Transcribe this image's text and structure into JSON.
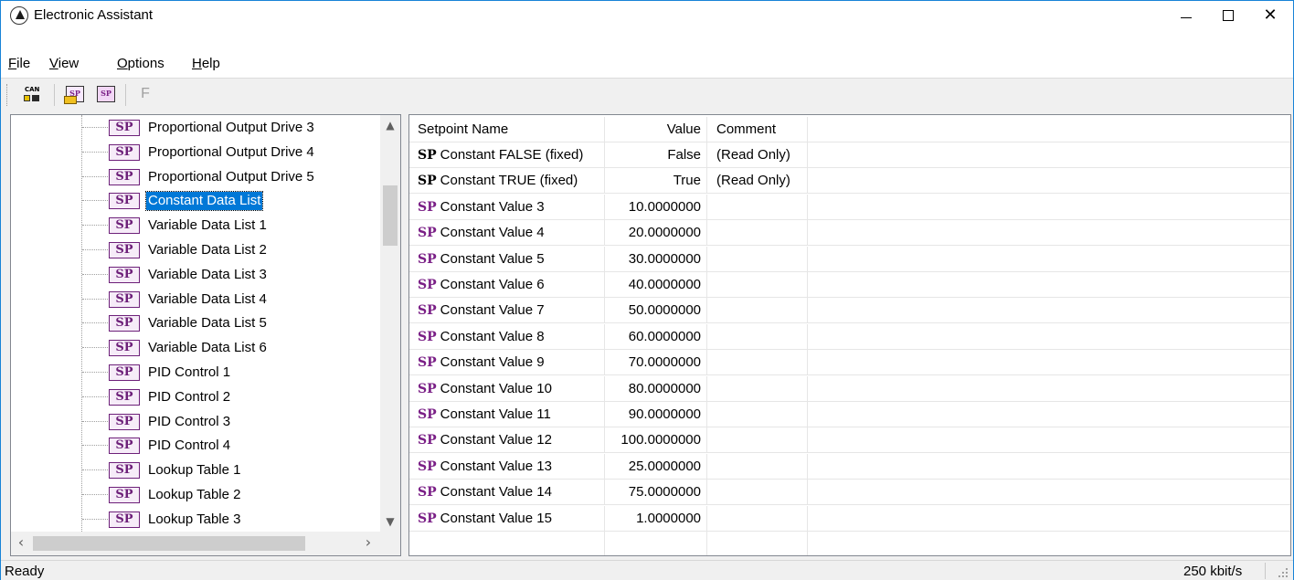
{
  "window": {
    "title": "Electronic Assistant",
    "buttons": {
      "minimize": "minimize-icon",
      "maximize": "maximize-icon",
      "close": "close-icon"
    }
  },
  "menu": {
    "items": [
      {
        "label": "File",
        "accel": "F",
        "rest": "ile"
      },
      {
        "label": "View",
        "accel": "V",
        "rest": "iew"
      },
      {
        "label": "Options",
        "accel": "O",
        "rest": "ptions"
      },
      {
        "label": "Help",
        "accel": "H",
        "rest": "elp"
      }
    ]
  },
  "toolbar": {
    "can_label": "CAN",
    "sp_label": "SP",
    "f_label": "F"
  },
  "tree": {
    "items": [
      {
        "label": "Proportional Output Drive 3",
        "icon": "SP"
      },
      {
        "label": "Proportional Output Drive 4",
        "icon": "SP"
      },
      {
        "label": "Proportional Output Drive 5",
        "icon": "SP"
      },
      {
        "label": "Constant Data List",
        "icon": "SP",
        "selected": true
      },
      {
        "label": "Variable Data List 1",
        "icon": "SP"
      },
      {
        "label": "Variable Data List 2",
        "icon": "SP"
      },
      {
        "label": "Variable Data List 3",
        "icon": "SP"
      },
      {
        "label": "Variable Data List 4",
        "icon": "SP"
      },
      {
        "label": "Variable Data List 5",
        "icon": "SP"
      },
      {
        "label": "Variable Data List 6",
        "icon": "SP"
      },
      {
        "label": "PID Control 1",
        "icon": "SP"
      },
      {
        "label": "PID Control 2",
        "icon": "SP"
      },
      {
        "label": "PID Control 3",
        "icon": "SP"
      },
      {
        "label": "PID Control 4",
        "icon": "SP"
      },
      {
        "label": "Lookup Table 1",
        "icon": "SP"
      },
      {
        "label": "Lookup Table 2",
        "icon": "SP"
      },
      {
        "label": "Lookup Table 3",
        "icon": "SP"
      }
    ],
    "scroll_up": "^",
    "scroll_down": "v",
    "scroll_left": "<",
    "scroll_right": ">"
  },
  "grid": {
    "headers": {
      "name": "Setpoint Name",
      "value": "Value",
      "comment": "Comment"
    },
    "rows": [
      {
        "tag": "SP",
        "name": "Constant FALSE (fixed)",
        "value": "False",
        "comment": "(Read Only)",
        "fixed": true
      },
      {
        "tag": "SP",
        "name": "Constant TRUE (fixed)",
        "value": "True",
        "comment": "(Read Only)",
        "fixed": true
      },
      {
        "tag": "SP",
        "name": "Constant Value 3",
        "value": "10.0000000",
        "comment": ""
      },
      {
        "tag": "SP",
        "name": "Constant Value 4",
        "value": "20.0000000",
        "comment": ""
      },
      {
        "tag": "SP",
        "name": "Constant Value 5",
        "value": "30.0000000",
        "comment": ""
      },
      {
        "tag": "SP",
        "name": "Constant Value 6",
        "value": "40.0000000",
        "comment": ""
      },
      {
        "tag": "SP",
        "name": "Constant Value 7",
        "value": "50.0000000",
        "comment": ""
      },
      {
        "tag": "SP",
        "name": "Constant Value 8",
        "value": "60.0000000",
        "comment": ""
      },
      {
        "tag": "SP",
        "name": "Constant Value 9",
        "value": "70.0000000",
        "comment": ""
      },
      {
        "tag": "SP",
        "name": "Constant Value 10",
        "value": "80.0000000",
        "comment": ""
      },
      {
        "tag": "SP",
        "name": "Constant Value 11",
        "value": "90.0000000",
        "comment": ""
      },
      {
        "tag": "SP",
        "name": "Constant Value 12",
        "value": "100.0000000",
        "comment": ""
      },
      {
        "tag": "SP",
        "name": "Constant Value 13",
        "value": "25.0000000",
        "comment": ""
      },
      {
        "tag": "SP",
        "name": "Constant Value 14",
        "value": "75.0000000",
        "comment": ""
      },
      {
        "tag": "SP",
        "name": "Constant Value 15",
        "value": "1.0000000",
        "comment": ""
      }
    ]
  },
  "status": {
    "text": "Ready",
    "speed": "250 kbit/s"
  },
  "colors": {
    "selection": "#0078d7",
    "sp_variable": "#7a1f86",
    "window_border": "#1883d7"
  }
}
